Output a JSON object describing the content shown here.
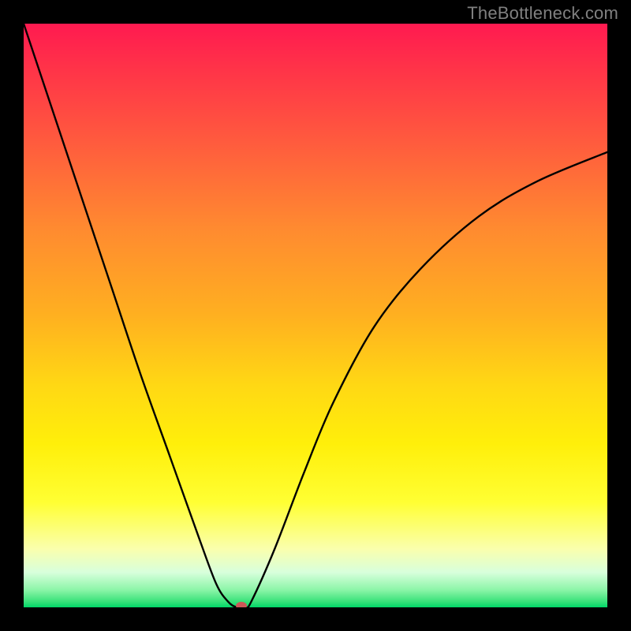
{
  "watermark": "TheBottleneck.com",
  "chart_data": {
    "type": "line",
    "title": "",
    "xlabel": "",
    "ylabel": "",
    "xlim": [
      0,
      100
    ],
    "ylim": [
      0,
      100
    ],
    "series": [
      {
        "name": "curve",
        "x": [
          0,
          5,
          10,
          15,
          20,
          25,
          30,
          33,
          35,
          36.5,
          38,
          39,
          43,
          48,
          53,
          60,
          68,
          78,
          88,
          100
        ],
        "y": [
          100,
          85,
          70,
          55,
          40,
          26,
          12,
          4,
          1,
          0,
          0,
          1,
          10,
          23,
          35,
          48,
          58,
          67,
          73,
          78
        ]
      }
    ],
    "marker": {
      "x": 37.3,
      "y": 0,
      "color": "#cc5858",
      "r": 6
    },
    "background_gradient": {
      "top": "#ff1a50",
      "middle": "#ffd814",
      "bottom": "#00d768"
    },
    "frame_color": "#000000",
    "line_color": "#000000"
  }
}
